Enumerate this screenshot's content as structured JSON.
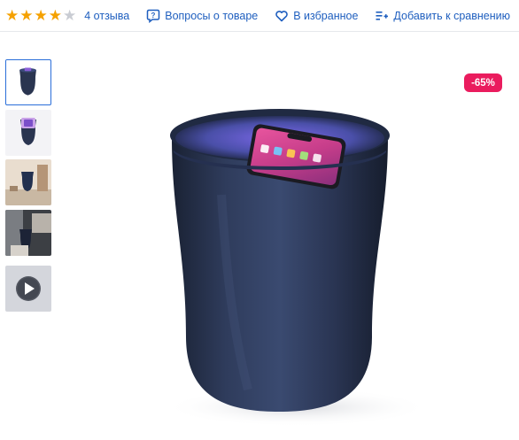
{
  "rating": {
    "stars_filled": 4,
    "stars_total": 5,
    "reviews_label": "4 отзыва"
  },
  "actions": {
    "questions_label": "Вопросы о товаре",
    "favorites_label": "В избранное",
    "compare_label": "Добавить к сравнению"
  },
  "gallery": {
    "thumbnails": [
      {
        "kind": "photo",
        "active": true
      },
      {
        "kind": "photo",
        "active": false
      },
      {
        "kind": "photo",
        "active": false
      },
      {
        "kind": "photo",
        "active": false
      },
      {
        "kind": "video",
        "active": false
      }
    ],
    "discount_badge": "-65%"
  },
  "icons": {
    "star": "star-icon",
    "questions": "question-bubble-icon",
    "favorites": "heart-icon",
    "compare": "compare-list-icon",
    "video": "play-icon"
  },
  "colors": {
    "link": "#1f5fbf",
    "star": "#f5a100",
    "star_empty": "#c9ccd3",
    "badge": "#ea1c5e",
    "active_border": "#2a6ed9"
  }
}
